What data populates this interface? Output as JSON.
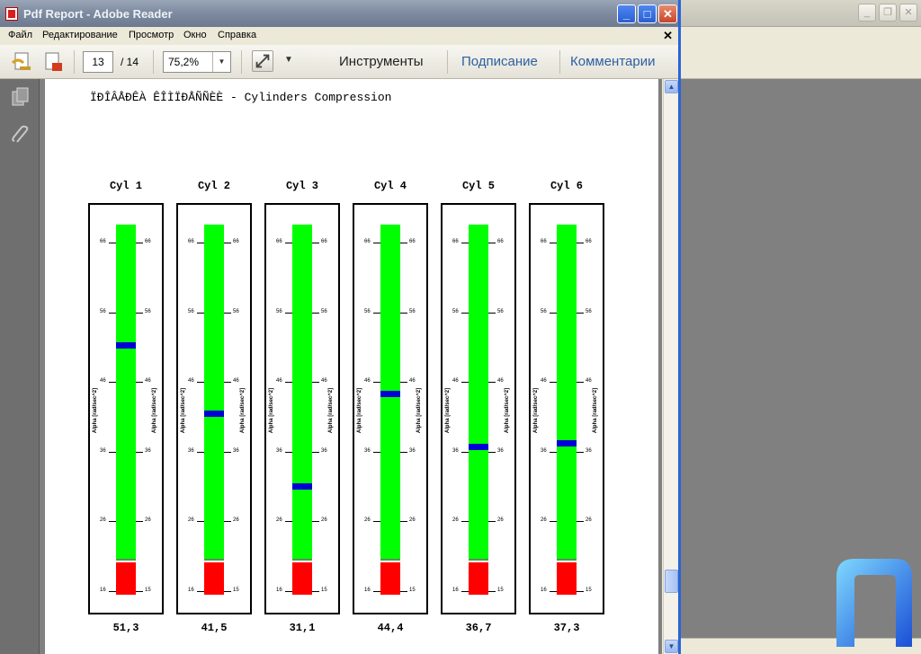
{
  "window": {
    "title": "Pdf Report - Adobe Reader"
  },
  "menu": [
    "Файл",
    "Редактирование",
    "Просмотр",
    "Окно",
    "Справка"
  ],
  "toolbar": {
    "page_current": "13",
    "page_total": "/ 14",
    "zoom": "75,2%",
    "tools_label": "Инструменты",
    "sign_label": "Подписание",
    "comments_label": "Комментарии"
  },
  "document": {
    "title": "ÏÐÎÂÅÐÊÀ ÊÎÌÏÐÅÑÑÈÈ - Cylinders Compression",
    "axis_label": "Alpha [rad/sec^2]",
    "scale_labels": [
      "66",
      "56",
      "46",
      "36",
      "26",
      "16"
    ],
    "scale_labels_right": [
      "66",
      "56",
      "46",
      "36",
      "26",
      "15"
    ],
    "cylinders": [
      {
        "name": "Cyl 1",
        "value": "51,3",
        "level": 51.3
      },
      {
        "name": "Cyl 2",
        "value": "41,5",
        "level": 41.5
      },
      {
        "name": "Cyl 3",
        "value": "31,1",
        "level": 31.1
      },
      {
        "name": "Cyl 4",
        "value": "44,4",
        "level": 44.4
      },
      {
        "name": "Cyl 5",
        "value": "36,7",
        "level": 36.7
      },
      {
        "name": "Cyl 6",
        "value": "37,3",
        "level": 37.3
      }
    ],
    "colors": {
      "ok": "#00ff00",
      "bad": "#ff0000",
      "marker": "#0000d6"
    }
  }
}
